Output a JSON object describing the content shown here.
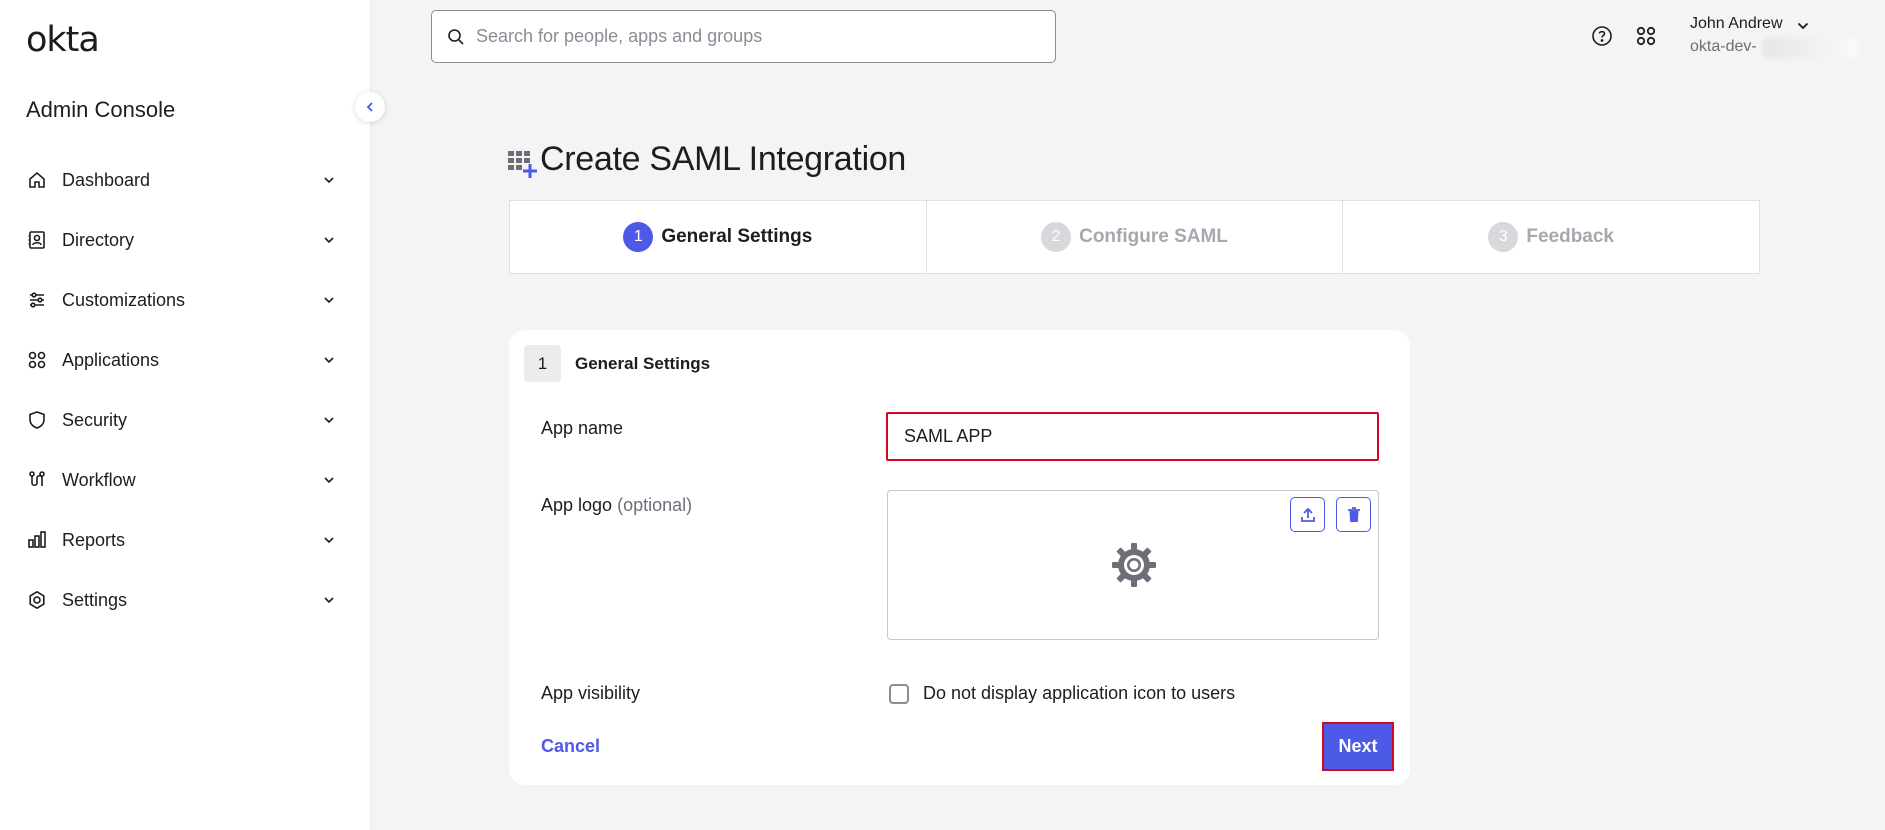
{
  "app": {
    "logo_text": "okta",
    "console_title": "Admin Console"
  },
  "sidebar": {
    "items": [
      {
        "label": "Dashboard",
        "icon": "home-icon"
      },
      {
        "label": "Directory",
        "icon": "directory-icon"
      },
      {
        "label": "Customizations",
        "icon": "sliders-icon"
      },
      {
        "label": "Applications",
        "icon": "apps-grid-icon"
      },
      {
        "label": "Security",
        "icon": "shield-icon"
      },
      {
        "label": "Workflow",
        "icon": "workflow-icon"
      },
      {
        "label": "Reports",
        "icon": "bar-chart-icon"
      },
      {
        "label": "Settings",
        "icon": "gear-icon"
      }
    ]
  },
  "topbar": {
    "search_placeholder": "Search for people, apps and groups",
    "user_name": "John Andrew",
    "user_org": "okta-dev-"
  },
  "page": {
    "title": "Create SAML Integration"
  },
  "stepper": {
    "steps": [
      {
        "num": "1",
        "label": "General Settings",
        "state": "active"
      },
      {
        "num": "2",
        "label": "Configure SAML",
        "state": "inactive"
      },
      {
        "num": "3",
        "label": "Feedback",
        "state": "inactive"
      }
    ]
  },
  "form": {
    "section_num": "1",
    "section_title": "General Settings",
    "app_name_label": "App name",
    "app_name_value": "SAML APP",
    "app_logo_label": "App logo",
    "app_logo_optional": "(optional)",
    "visibility_label": "App visibility",
    "visibility_checkbox_label": "Do not display application icon to users",
    "visibility_checked": false,
    "cancel_label": "Cancel",
    "next_label": "Next"
  },
  "colors": {
    "accent": "#4d5ae5",
    "highlight": "#d3091f",
    "background": "#f4f4f4"
  }
}
